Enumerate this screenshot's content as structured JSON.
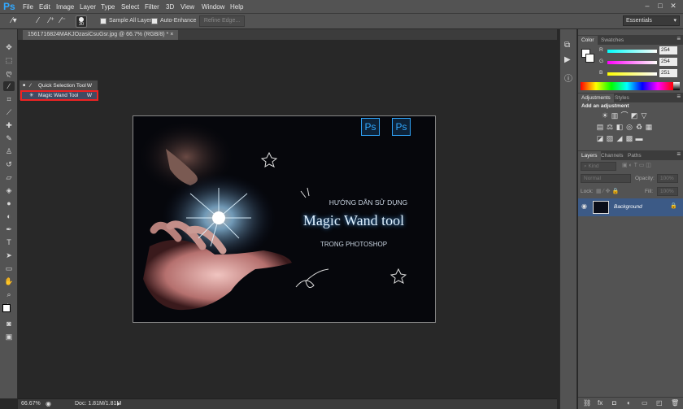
{
  "app": {
    "logo": "Ps"
  },
  "menu": [
    "File",
    "Edit",
    "Image",
    "Layer",
    "Type",
    "Select",
    "Filter",
    "3D",
    "View",
    "Window",
    "Help"
  ],
  "window_controls": {
    "minimize": "–",
    "maximize": "□",
    "close": "✕"
  },
  "options": {
    "brush_size": "30",
    "sample_all_layers": "Sample All Layers",
    "auto_enhance": "Auto-Enhance",
    "refine_edge": "Refine Edge...",
    "workspace": "Essentials"
  },
  "document": {
    "tab_title": "1561716824MAKJOzasiCsuGsr.jpg @ 66.7% (RGB/8) *",
    "tab_close": "×"
  },
  "flyout": {
    "items": [
      {
        "label": "Quick Selection Tool",
        "key": "W"
      },
      {
        "label": "Magic Wand Tool",
        "key": "W"
      }
    ]
  },
  "canvas_image": {
    "heading_small": "HƯỚNG DẪN SỬ DỤNG",
    "heading_big": "Magic Wand tool",
    "heading_sub": "TRONG PHOTOSHOP",
    "badge1": "Ps",
    "badge2": "Ps"
  },
  "status": {
    "zoom": "66.67%",
    "doc": "Doc: 1.81M/1.81M"
  },
  "color_panel": {
    "tabs": [
      "Color",
      "Swatches"
    ],
    "r_label": "R",
    "g_label": "G",
    "b_label": "B",
    "r": "254",
    "g": "254",
    "b": "251"
  },
  "adjust_panel": {
    "tabs": [
      "Adjustments",
      "Styles"
    ],
    "add_label": "Add an adjustment"
  },
  "layers_panel": {
    "tabs": [
      "Layers",
      "Channels",
      "Paths"
    ],
    "kind": "Kind",
    "blend": "Normal",
    "opacity_label": "Opacity:",
    "opacity": "100%",
    "lock_label": "Lock:",
    "fill_label": "Fill:",
    "fill": "100%",
    "layer_name": "Background"
  },
  "colors": {
    "accent": "#31a8ff",
    "selection": "#e22222",
    "layer_highlight": "#3c5a86"
  }
}
